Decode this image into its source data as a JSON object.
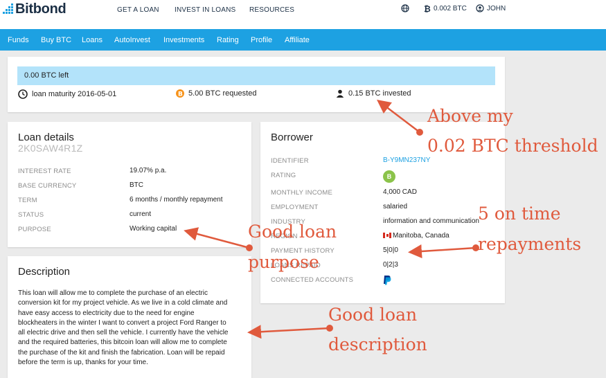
{
  "brand": {
    "name": "Bitbond",
    "accent": "#1da1e2"
  },
  "topnav": {
    "get_loan": "GET A LOAN",
    "invest": "INVEST IN LOANS",
    "resources": "RESOURCES"
  },
  "account": {
    "balance": "0.002 BTC",
    "user": "JOHN",
    "icons": [
      "globe-icon",
      "bitcoin-icon",
      "user-icon"
    ]
  },
  "mainnav": [
    "Funds",
    "Buy BTC",
    "Loans",
    "AutoInvest",
    "Investments",
    "Rating",
    "Profile",
    "Affiliate"
  ],
  "funding": {
    "left": "0.00 BTC left",
    "maturity": "loan maturity 2016-05-01",
    "requested": "5.00 BTC requested",
    "invested": "0.15 BTC invested"
  },
  "loan": {
    "title": "Loan details",
    "id": "2K0SAW4R1Z",
    "rows": [
      {
        "label": "INTEREST RATE",
        "value": "19.07% p.a."
      },
      {
        "label": "BASE CURRENCY",
        "value": "BTC"
      },
      {
        "label": "TERM",
        "value": "6 months / monthly repayment"
      },
      {
        "label": "STATUS",
        "value": "current"
      },
      {
        "label": "PURPOSE",
        "value": "Working capital"
      }
    ]
  },
  "borrower": {
    "title": "Borrower",
    "identifier_label": "IDENTIFIER",
    "identifier": "B-Y9MN237NY",
    "rating_label": "RATING",
    "rating": "B",
    "income_label": "MONTHLY INCOME",
    "income": "4,000 CAD",
    "employment_label": "EMPLOYMENT",
    "employment": "salaried",
    "industry_label": "INDUSTRY",
    "industry": "information and communication",
    "region_label": "REGION",
    "region": "Manitoba, Canada",
    "history_label": "PAYMENT HISTORY",
    "history": "5|0|0",
    "loans_label": "LOANS REPAID",
    "loans": "0|2|3",
    "accounts_label": "CONNECTED ACCOUNTS",
    "accounts_icon": "paypal-icon"
  },
  "description": {
    "title": "Description",
    "lines": [
      "This loan will allow me to complete the purchase of an electric",
      "conversion kit for my project vehicle. As we live in a cold climate and",
      "have easy access to electricity due to the need for engine",
      "blockheaters in the winter I want to convert a project Ford Ranger to",
      "all electric drive and then sell the vehicle. I currently have the vehicle",
      "and the required batteries, this bitcoin loan will allow me to complete",
      "the purchase of the kit and finish the fabrication. Loan will be repaid",
      "before the term is up, thanks for your time."
    ]
  },
  "annotations": {
    "color": "#e05a3d",
    "threshold_1": "Above my",
    "threshold_2": "0.02 BTC threshold",
    "purpose_1": "Good loan",
    "purpose_2": "purpose",
    "repay_1": "5 on time",
    "repay_2": "repayments",
    "desc_1": "Good loan",
    "desc_2": "description"
  }
}
